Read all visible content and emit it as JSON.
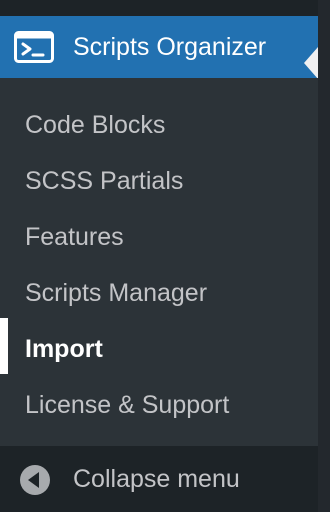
{
  "menu": {
    "title": "Scripts Organizer",
    "icon": "terminal-window-icon",
    "accent_color": "#2271b1"
  },
  "submenu": {
    "items": [
      {
        "label": "Code Blocks",
        "current": false
      },
      {
        "label": "SCSS Partials",
        "current": false
      },
      {
        "label": "Features",
        "current": false
      },
      {
        "label": "Scripts Manager",
        "current": false
      },
      {
        "label": "Import",
        "current": true
      },
      {
        "label": "License & Support",
        "current": false
      }
    ]
  },
  "collapse": {
    "label": "Collapse menu",
    "icon": "collapse-arrow-icon"
  }
}
